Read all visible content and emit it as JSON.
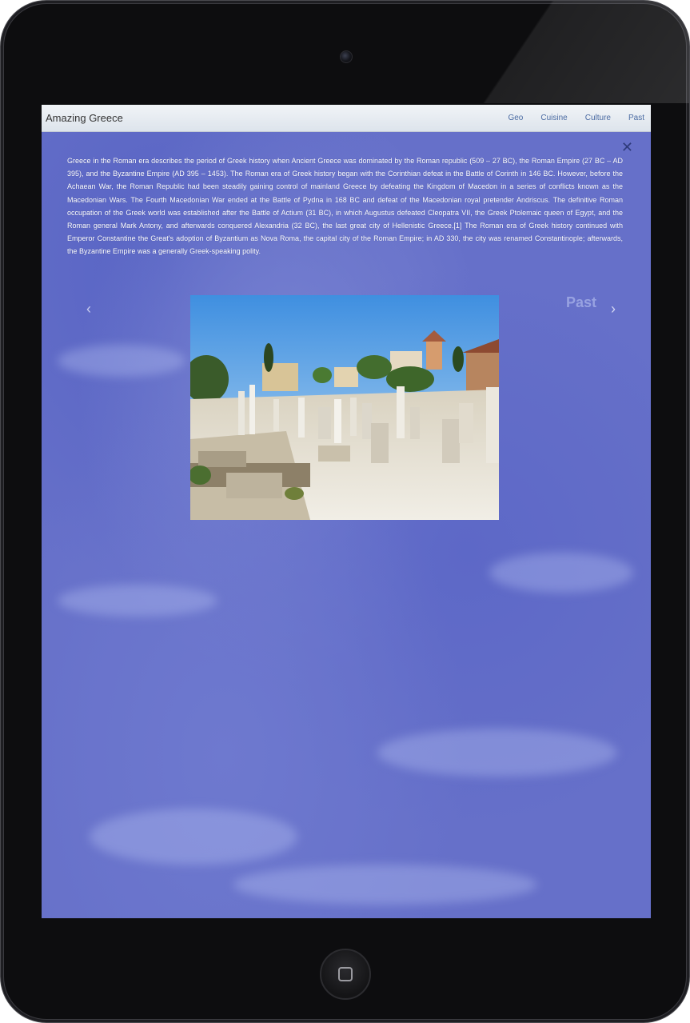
{
  "device": {
    "type": "tablet"
  },
  "navbar": {
    "brand": "Amazing Greece",
    "links": [
      {
        "label": "Geo"
      },
      {
        "label": "Cuisine"
      },
      {
        "label": "Culture"
      },
      {
        "label": "Past"
      }
    ]
  },
  "modal": {
    "close_symbol": "✕",
    "article_text": "Greece in the Roman era describes the period of Greek history when Ancient Greece was dominated by the Roman republic (509 – 27 BC), the Roman Empire (27 BC – AD 395), and the Byzantine Empire (AD 395 – 1453). The Roman era of Greek history began with the Corinthian defeat in the Battle of Corinth in 146 BC. However, before the Achaean War, the Roman Republic had been steadily gaining control of mainland Greece by defeating the Kingdom of Macedon in a series of conflicts known as the Macedonian Wars. The Fourth Macedonian War ended at the Battle of Pydna in 168 BC and defeat of the Macedonian royal pretender Andriscus. The definitive Roman occupation of the Greek world was established after the Battle of Actium (31 BC), in which Augustus defeated Cleopatra VII, the Greek Ptolemaic queen of Egypt, and the Roman general Mark Antony, and afterwards conquered Alexandria (32 BC), the last great city of Hellenistic Greece.[1] The Roman era of Greek history continued with Emperor Constantine the Great's adoption of Byzantium as Nova Roma, the capital city of the Roman Empire; in AD 330, the city was renamed Constantinople; afterwards, the Byzantine Empire was a generally Greek-speaking polity.",
    "carousel": {
      "prev_symbol": "‹",
      "next_symbol": "›",
      "section_label": "Past"
    }
  },
  "colors": {
    "screen_bg": "#6670c9",
    "navbar_bg": "#e8edf2",
    "nav_link": "#4c6ca3",
    "text": "#ffffff"
  }
}
